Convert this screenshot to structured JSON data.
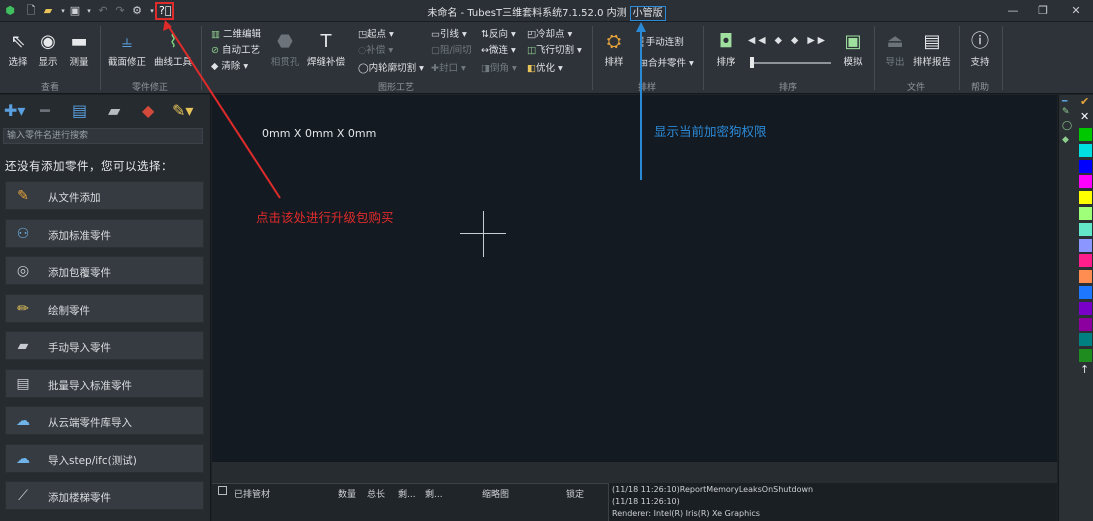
{
  "window": {
    "title": "未命名 - TubesT三维套料系统7.1.52.0 内测",
    "edition": "小管版",
    "min_icon": "minimize-icon",
    "max_icon": "restore-icon",
    "close_icon": "close-icon"
  },
  "quick_access": [
    "app-logo-icon",
    "new-file-icon",
    "open-folder-icon",
    "save-icon",
    "undo-icon",
    "redo-icon",
    "settings-gear-icon",
    "help-icon"
  ],
  "ribbon": {
    "groups": {
      "view": "查看",
      "part_fix": "零件修正",
      "graphic_process": "图形工艺",
      "nesting": "排样",
      "sort": "排序",
      "file": "文件",
      "help": "帮助"
    },
    "buttons": {
      "select": "选择",
      "display": "显示",
      "measure": "测量",
      "section_fix": "截面修正",
      "curve_tool": "曲线工具",
      "edit_2d": "二维编辑",
      "auto_process": "自动工艺",
      "clear": "清除",
      "bevel_hole": "相贯孔",
      "weld_comp": "焊缝补偿",
      "start_point": "起点",
      "compensation": "补偿",
      "inner_contour_cut": "内轮廓切割",
      "lead_line": "引线",
      "gap_cut": "阻/间切",
      "seal": "封口",
      "reverse": "反向",
      "micro_link": "微连",
      "chamfer": "倒角",
      "cool_point": "冷却点",
      "fly_cut": "飞行切割",
      "optimize": "优化",
      "nest": "排样",
      "manual_link": "手动连割",
      "merge_parts": "合并零件",
      "sort": "排序",
      "simulate": "模拟",
      "export": "导出",
      "nest_report": "排样报告",
      "support": "支持"
    }
  },
  "left_panel": {
    "search_placeholder": "输入零件名进行搜索",
    "empty_hint": "还没有添加零件，您可以选择：",
    "actions": [
      {
        "label": "从文件添加",
        "icon": "add-from-file-icon"
      },
      {
        "label": "添加标准零件",
        "icon": "standard-parts-icon"
      },
      {
        "label": "添加包覆零件",
        "icon": "wrapped-part-icon"
      },
      {
        "label": "绘制零件",
        "icon": "pencil-draw-icon"
      },
      {
        "label": "手动导入零件",
        "icon": "manual-import-icon"
      },
      {
        "label": "批量导入标准零件",
        "icon": "batch-import-icon"
      },
      {
        "label": "从云端零件库导入",
        "icon": "cloud-import-icon"
      },
      {
        "label": "导入step/ifc(测试)",
        "icon": "step-import-icon"
      },
      {
        "label": "添加楼梯零件",
        "icon": "stairs-part-icon"
      }
    ]
  },
  "canvas": {
    "dimensions": "0mm X 0mm X 0mm",
    "annotation_upgrade": "点击该处进行升级包购买",
    "annotation_edition": "显示当前加密狗权限"
  },
  "bottom_table": {
    "headers": [
      "已排管材",
      "数量",
      "总长",
      "剩...",
      "剩...",
      "缩略图",
      "锁定"
    ]
  },
  "log_lines": [
    "(11/18 11:26:10)ReportMemoryLeaksOnShutdown",
    "(11/18 11:26:10)",
    "Renderer: Intel(R) Iris(R) Xe Graphics"
  ],
  "colors": {
    "annotation_red": "#e02b2b",
    "annotation_blue": "#2b8ad6",
    "swatches": [
      "#00c800",
      "#00e0e0",
      "#0000ff",
      "#ff00ff",
      "#ffff00",
      "#a0ff78",
      "#64e6c8",
      "#8c96ff",
      "#ff1e8c",
      "#ff8c50",
      "#1e78ff",
      "#7800c8",
      "#8c00a0",
      "#008080",
      "#1e8c1e"
    ]
  }
}
